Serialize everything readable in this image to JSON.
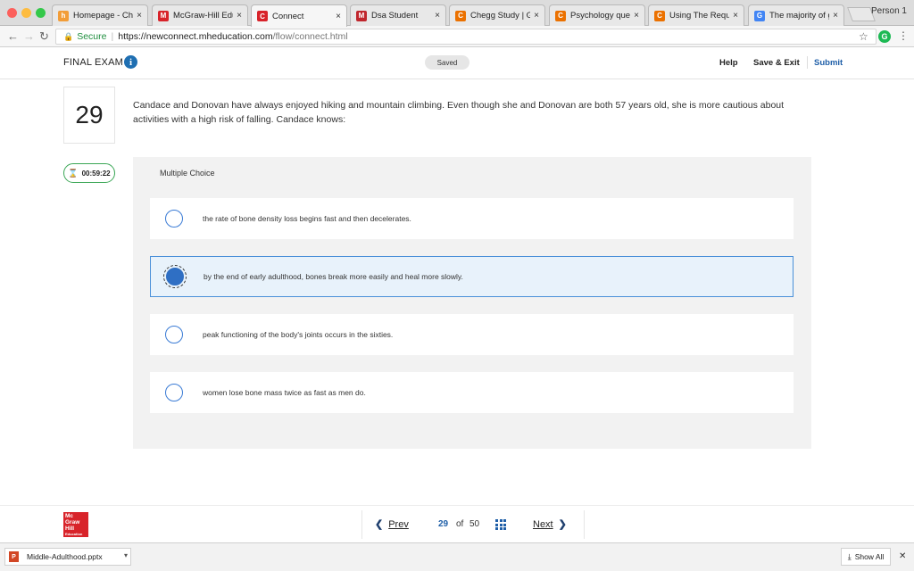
{
  "browser": {
    "tabs": [
      {
        "label": "Homepage - Chat",
        "favicon": "homepage-icon",
        "color": "#f29d38",
        "glyph": "h"
      },
      {
        "label": "McGraw-Hill Educ",
        "favicon": "mcgraw-hill-icon",
        "color": "#d8232a",
        "glyph": "M"
      },
      {
        "label": "Connect",
        "favicon": "connect-icon",
        "color": "#d8232a",
        "glyph": "C"
      },
      {
        "label": "Dsa Student",
        "favicon": "dsa-icon",
        "color": "#c0262d",
        "glyph": "M"
      },
      {
        "label": "Chegg Study | Gu",
        "favicon": "chegg-icon",
        "color": "#eb7100",
        "glyph": "C"
      },
      {
        "label": "Psychology quest",
        "favicon": "chegg-icon",
        "color": "#eb7100",
        "glyph": "C"
      },
      {
        "label": "Using The Requir",
        "favicon": "chegg-icon",
        "color": "#eb7100",
        "glyph": "C"
      },
      {
        "label": "The majority of g",
        "favicon": "google-icon",
        "color": "#4285f4",
        "glyph": "G"
      }
    ],
    "active_tab_index": 2,
    "profile": "Person 1",
    "secure_label": "Secure",
    "url_base": "https://newconnect.mheducation.com",
    "url_path": "/flow/connect.html"
  },
  "header": {
    "title": "FINAL EXAM",
    "status": "Saved",
    "help": "Help",
    "save_exit": "Save & Exit",
    "submit": "Submit"
  },
  "question": {
    "number": "29",
    "text": "Candace and Donovan have always enjoyed hiking and mountain climbing. Even though she and Donovan are both 57 years old, she is more cautious about activities with a high risk of falling. Candace knows:",
    "timer": "00:59:22",
    "type": "Multiple Choice",
    "options": [
      {
        "label": "the rate of bone density loss begins fast and then decelerates.",
        "selected": false
      },
      {
        "label": "by the end of early adulthood, bones break more easily and heal more slowly.",
        "selected": true
      },
      {
        "label": "peak functioning of the body's joints occurs in the sixties.",
        "selected": false
      },
      {
        "label": "women lose bone mass twice as fast as men do.",
        "selected": false
      }
    ]
  },
  "footer": {
    "logo_lines": [
      "Mc",
      "Graw",
      "Hill",
      "Education"
    ],
    "prev": "Prev",
    "current_page": "29",
    "of": "of",
    "total_pages": "50",
    "next": "Next"
  },
  "downloads": {
    "file": "Middle-Adulthood.pptx",
    "show_all": "Show All"
  },
  "colors": {
    "accent": "#1f5fa8",
    "selected_bg": "#e8f2fb",
    "timer_border": "#3aa655"
  }
}
